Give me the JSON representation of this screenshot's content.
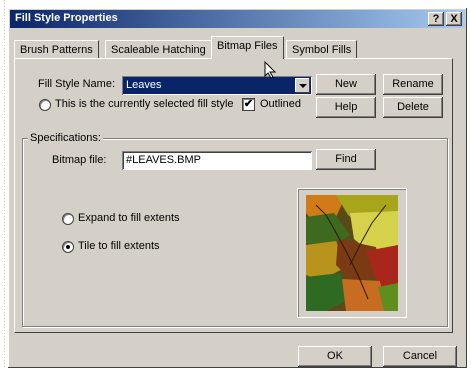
{
  "window": {
    "title": "Fill Style Properties"
  },
  "titlebar": {
    "help_label": "?",
    "close_label": "X"
  },
  "tabs": [
    {
      "label": "Brush Patterns"
    },
    {
      "label": "Scaleable Hatching"
    },
    {
      "label": "Bitmap Files"
    },
    {
      "label": "Symbol Fills"
    }
  ],
  "fill_style": {
    "name_label": "Fill Style Name:",
    "name_value": "Leaves",
    "current_label": "This is the currently selected fill style",
    "outlined_label": "Outlined",
    "outlined_checked": true
  },
  "buttons": {
    "new": "New",
    "rename": "Rename",
    "help": "Help",
    "delete": "Delete",
    "find": "Find",
    "ok": "OK",
    "cancel": "Cancel"
  },
  "specifications": {
    "title": "Specifications:",
    "bitmap_label": "Bitmap file:",
    "bitmap_value": "#LEAVES.BMP",
    "expand_label": "Expand to fill extents",
    "tile_label": "Tile to fill extents",
    "selected_option": "tile"
  },
  "colors": {
    "title_start": "#0a246a",
    "title_end": "#a6caf0",
    "face": "#d4d0c8"
  }
}
